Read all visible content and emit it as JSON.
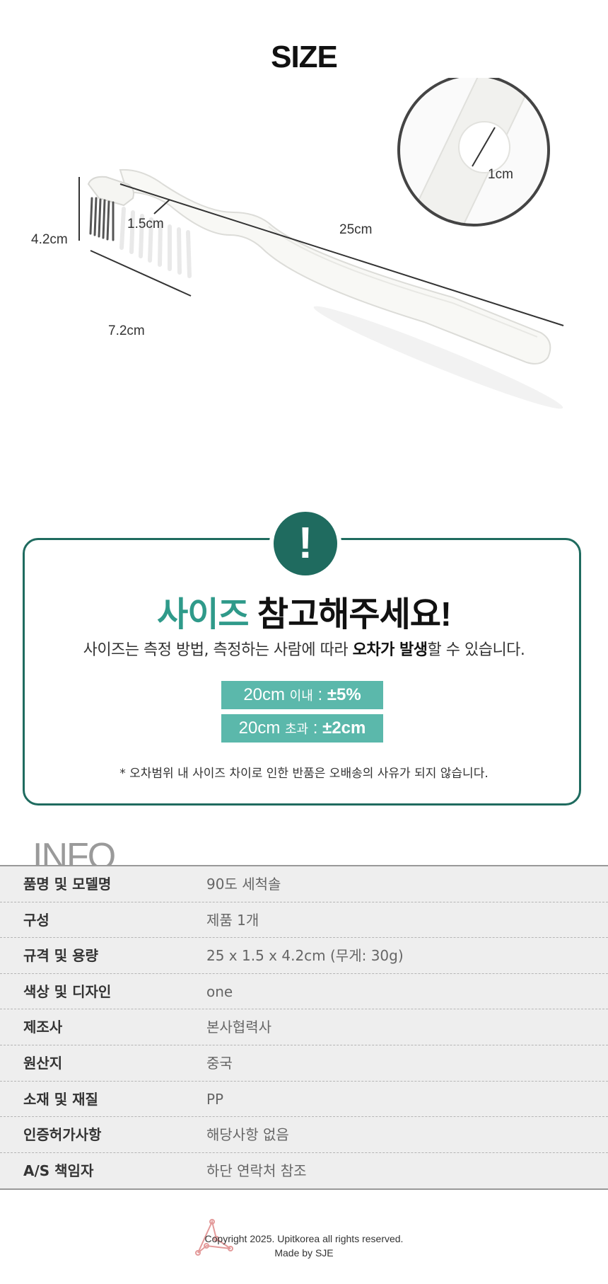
{
  "size": {
    "title": "SIZE",
    "dimensions": {
      "length": "25cm",
      "height": "4.2cm",
      "width": "7.2cm",
      "neck": "1.5cm",
      "hole": "1cm"
    }
  },
  "notice": {
    "icon": "exclamation-icon",
    "icon_glyph": "!",
    "title_accent": "사이즈",
    "title_rest": " 참고해주세요!",
    "desc_pre": "사이즈는 측정 방법, 측정하는 사람에 따라 ",
    "desc_bold": "오차가 발생",
    "desc_post": "할 수 있습니다.",
    "tolerances": [
      {
        "size": "20cm",
        "cond": "이내",
        "sep": " : ",
        "value": "±5%"
      },
      {
        "size": "20cm",
        "cond": "초과",
        "sep": " : ",
        "value": "±2cm"
      }
    ],
    "footnote": "* 오차범위 내 사이즈 차이로 인한 반품은 오배송의 사유가 되지 않습니다."
  },
  "info": {
    "title": "INFO",
    "rows": [
      {
        "key": "품명 및 모델명",
        "value": "90도 세척솔"
      },
      {
        "key": "구성",
        "value": "제품 1개"
      },
      {
        "key": "규격 및 용량",
        "value": "25 x 1.5 x 4.2cm (무게: 30g)"
      },
      {
        "key": "색상 및 디자인",
        "value": "one"
      },
      {
        "key": "제조사",
        "value": "본사협력사"
      },
      {
        "key": "원산지",
        "value": "중국"
      },
      {
        "key": "소재 및 재질",
        "value": "PP"
      },
      {
        "key": "인증허가사항",
        "value": "해당사항  없음"
      },
      {
        "key": "A/S 책임자",
        "value": "하단 연락처 참조"
      }
    ]
  },
  "footer": {
    "copyright": "Copyright 2025. Upitkorea all rights reserved.",
    "made_by": "Made by SJE"
  },
  "colors": {
    "brand_dark": "#1f6b5f",
    "brand_accent": "#2f9a8a",
    "tolerance_bg": "#5bb8ab",
    "table_bg": "#eeeeee"
  }
}
